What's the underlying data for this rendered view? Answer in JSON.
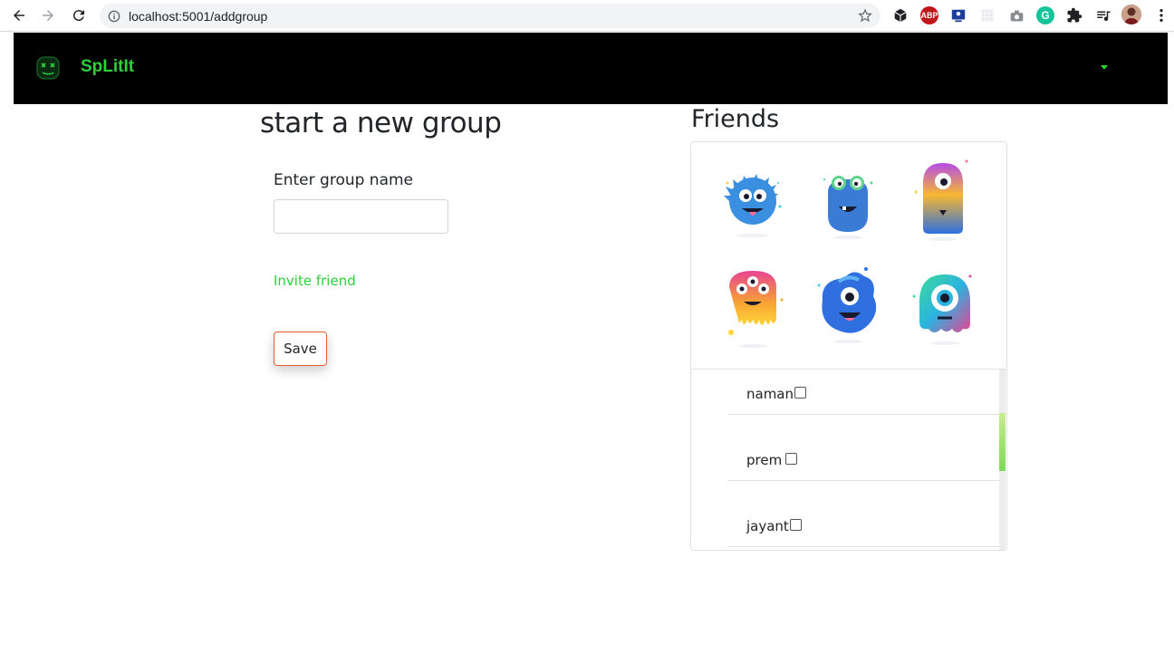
{
  "browser": {
    "url": "localhost:5001/addgroup",
    "extensions": [
      "cube-icon",
      "adblock-icon",
      "screen-icon",
      "grid-icon",
      "camera-icon",
      "grammarly-icon",
      "puzzle-icon",
      "playlist-icon",
      "avatar-icon"
    ],
    "adblock_label": "ABP",
    "grammarly_label": "G"
  },
  "navbar": {
    "brand": "SpLitIt",
    "brand_color": "#2bd23a",
    "background": "#000000"
  },
  "form": {
    "title": "start a new group",
    "group_name_label": "Enter group name",
    "group_name_value": "",
    "invite_link": "Invite friend",
    "save_label": "Save"
  },
  "friends": {
    "title": "Friends",
    "list": [
      {
        "name": "naman",
        "checked": false
      },
      {
        "name": "prem",
        "checked": false
      },
      {
        "name": "jayant",
        "checked": false
      }
    ]
  }
}
